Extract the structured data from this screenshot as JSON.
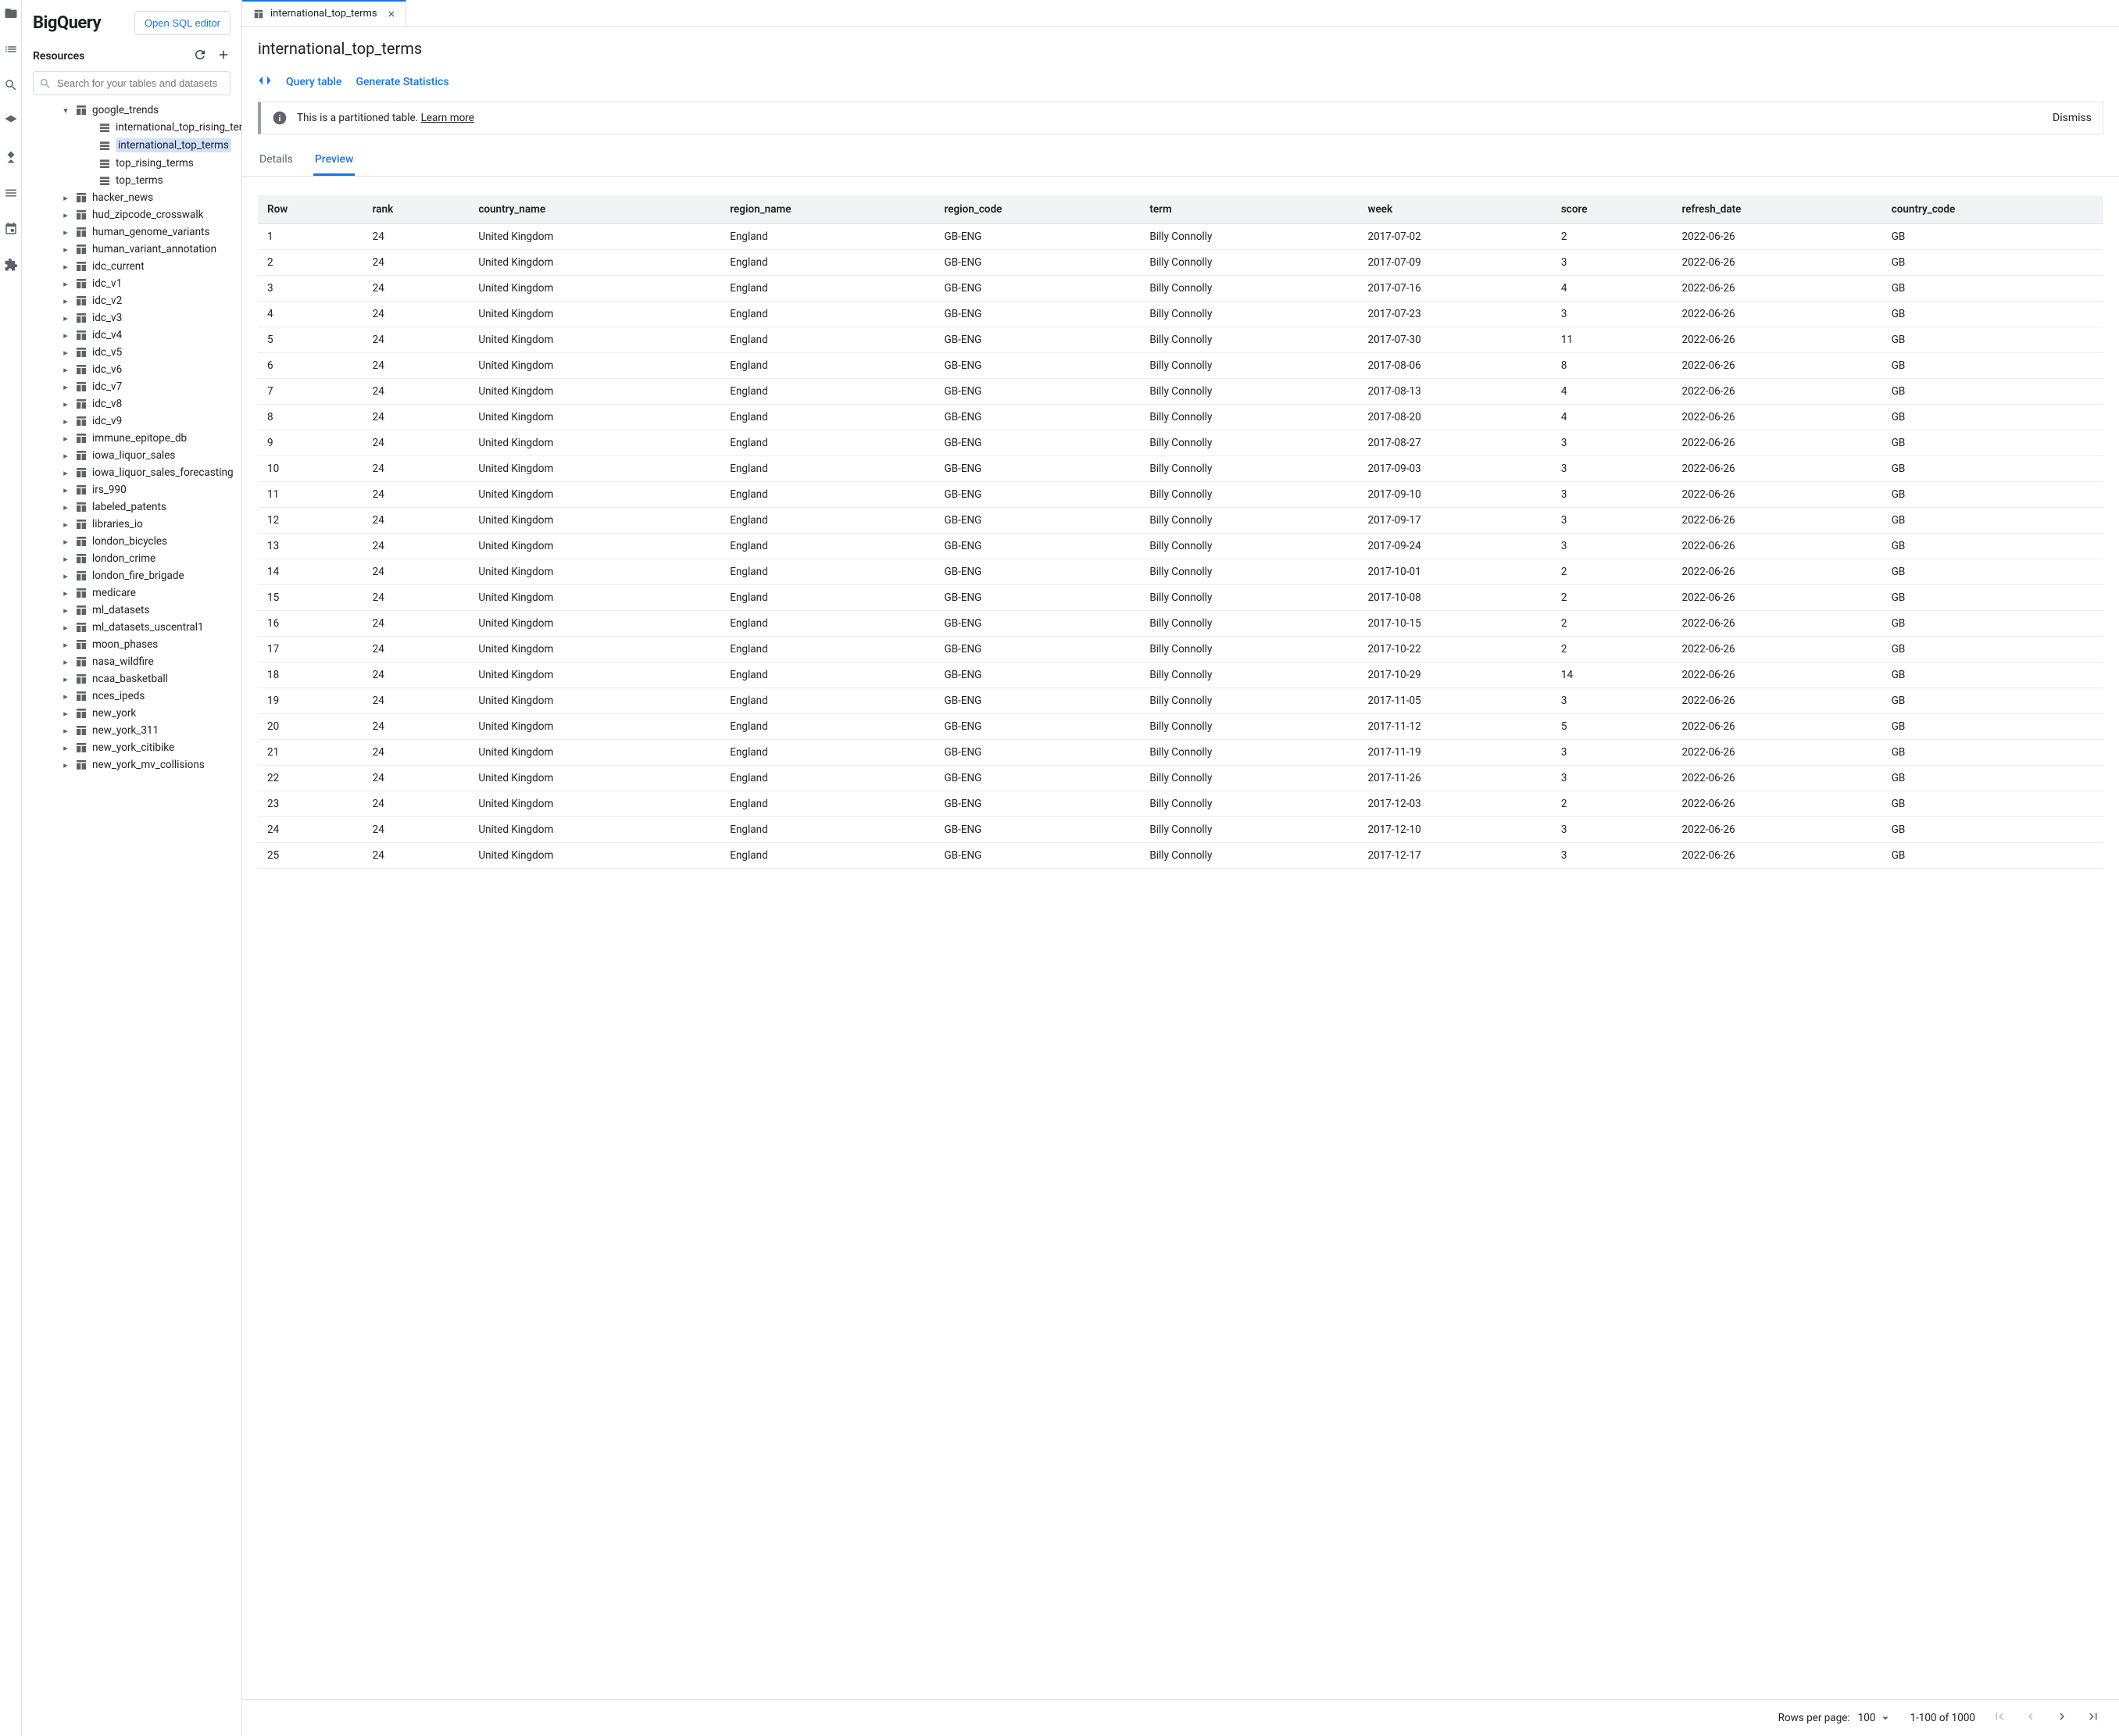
{
  "brand": "BigQuery",
  "open_sql": "Open SQL editor",
  "resources_label": "Resources",
  "search_placeholder": "Search for your tables and datasets",
  "tree": {
    "expanded": {
      "label": "google_trends",
      "children": [
        "international_top_rising_terms",
        "international_top_terms",
        "top_rising_terms",
        "top_terms"
      ],
      "selected_index": 1
    },
    "datasets": [
      "hacker_news",
      "hud_zipcode_crosswalk",
      "human_genome_variants",
      "human_variant_annotation",
      "idc_current",
      "idc_v1",
      "idc_v2",
      "idc_v3",
      "idc_v4",
      "idc_v5",
      "idc_v6",
      "idc_v7",
      "idc_v8",
      "idc_v9",
      "immune_epitope_db",
      "iowa_liquor_sales",
      "iowa_liquor_sales_forecasting",
      "irs_990",
      "labeled_patents",
      "libraries_io",
      "london_bicycles",
      "london_crime",
      "london_fire_brigade",
      "medicare",
      "ml_datasets",
      "ml_datasets_uscentral1",
      "moon_phases",
      "nasa_wildfire",
      "ncaa_basketball",
      "nces_ipeds",
      "new_york",
      "new_york_311",
      "new_york_citibike",
      "new_york_mv_collisions"
    ]
  },
  "tab": {
    "label": "international_top_terms"
  },
  "page_title": "international_top_terms",
  "actions": {
    "query": "Query table",
    "stats": "Generate Statistics"
  },
  "banner": {
    "text": "This is a partitioned table. ",
    "learn": "Learn more",
    "dismiss": "Dismiss"
  },
  "content_tabs": {
    "details": "Details",
    "preview": "Preview"
  },
  "columns": [
    "Row",
    "rank",
    "country_name",
    "region_name",
    "region_code",
    "term",
    "week",
    "score",
    "refresh_date",
    "country_code"
  ],
  "rows": [
    [
      "1",
      "24",
      "United Kingdom",
      "England",
      "GB-ENG",
      "Billy Connolly",
      "2017-07-02",
      "2",
      "2022-06-26",
      "GB"
    ],
    [
      "2",
      "24",
      "United Kingdom",
      "England",
      "GB-ENG",
      "Billy Connolly",
      "2017-07-09",
      "3",
      "2022-06-26",
      "GB"
    ],
    [
      "3",
      "24",
      "United Kingdom",
      "England",
      "GB-ENG",
      "Billy Connolly",
      "2017-07-16",
      "4",
      "2022-06-26",
      "GB"
    ],
    [
      "4",
      "24",
      "United Kingdom",
      "England",
      "GB-ENG",
      "Billy Connolly",
      "2017-07-23",
      "3",
      "2022-06-26",
      "GB"
    ],
    [
      "5",
      "24",
      "United Kingdom",
      "England",
      "GB-ENG",
      "Billy Connolly",
      "2017-07-30",
      "11",
      "2022-06-26",
      "GB"
    ],
    [
      "6",
      "24",
      "United Kingdom",
      "England",
      "GB-ENG",
      "Billy Connolly",
      "2017-08-06",
      "8",
      "2022-06-26",
      "GB"
    ],
    [
      "7",
      "24",
      "United Kingdom",
      "England",
      "GB-ENG",
      "Billy Connolly",
      "2017-08-13",
      "4",
      "2022-06-26",
      "GB"
    ],
    [
      "8",
      "24",
      "United Kingdom",
      "England",
      "GB-ENG",
      "Billy Connolly",
      "2017-08-20",
      "4",
      "2022-06-26",
      "GB"
    ],
    [
      "9",
      "24",
      "United Kingdom",
      "England",
      "GB-ENG",
      "Billy Connolly",
      "2017-08-27",
      "3",
      "2022-06-26",
      "GB"
    ],
    [
      "10",
      "24",
      "United Kingdom",
      "England",
      "GB-ENG",
      "Billy Connolly",
      "2017-09-03",
      "3",
      "2022-06-26",
      "GB"
    ],
    [
      "11",
      "24",
      "United Kingdom",
      "England",
      "GB-ENG",
      "Billy Connolly",
      "2017-09-10",
      "3",
      "2022-06-26",
      "GB"
    ],
    [
      "12",
      "24",
      "United Kingdom",
      "England",
      "GB-ENG",
      "Billy Connolly",
      "2017-09-17",
      "3",
      "2022-06-26",
      "GB"
    ],
    [
      "13",
      "24",
      "United Kingdom",
      "England",
      "GB-ENG",
      "Billy Connolly",
      "2017-09-24",
      "3",
      "2022-06-26",
      "GB"
    ],
    [
      "14",
      "24",
      "United Kingdom",
      "England",
      "GB-ENG",
      "Billy Connolly",
      "2017-10-01",
      "2",
      "2022-06-26",
      "GB"
    ],
    [
      "15",
      "24",
      "United Kingdom",
      "England",
      "GB-ENG",
      "Billy Connolly",
      "2017-10-08",
      "2",
      "2022-06-26",
      "GB"
    ],
    [
      "16",
      "24",
      "United Kingdom",
      "England",
      "GB-ENG",
      "Billy Connolly",
      "2017-10-15",
      "2",
      "2022-06-26",
      "GB"
    ],
    [
      "17",
      "24",
      "United Kingdom",
      "England",
      "GB-ENG",
      "Billy Connolly",
      "2017-10-22",
      "2",
      "2022-06-26",
      "GB"
    ],
    [
      "18",
      "24",
      "United Kingdom",
      "England",
      "GB-ENG",
      "Billy Connolly",
      "2017-10-29",
      "14",
      "2022-06-26",
      "GB"
    ],
    [
      "19",
      "24",
      "United Kingdom",
      "England",
      "GB-ENG",
      "Billy Connolly",
      "2017-11-05",
      "3",
      "2022-06-26",
      "GB"
    ],
    [
      "20",
      "24",
      "United Kingdom",
      "England",
      "GB-ENG",
      "Billy Connolly",
      "2017-11-12",
      "5",
      "2022-06-26",
      "GB"
    ],
    [
      "21",
      "24",
      "United Kingdom",
      "England",
      "GB-ENG",
      "Billy Connolly",
      "2017-11-19",
      "3",
      "2022-06-26",
      "GB"
    ],
    [
      "22",
      "24",
      "United Kingdom",
      "England",
      "GB-ENG",
      "Billy Connolly",
      "2017-11-26",
      "3",
      "2022-06-26",
      "GB"
    ],
    [
      "23",
      "24",
      "United Kingdom",
      "England",
      "GB-ENG",
      "Billy Connolly",
      "2017-12-03",
      "2",
      "2022-06-26",
      "GB"
    ],
    [
      "24",
      "24",
      "United Kingdom",
      "England",
      "GB-ENG",
      "Billy Connolly",
      "2017-12-10",
      "3",
      "2022-06-26",
      "GB"
    ],
    [
      "25",
      "24",
      "United Kingdom",
      "England",
      "GB-ENG",
      "Billy Connolly",
      "2017-12-17",
      "3",
      "2022-06-26",
      "GB"
    ]
  ],
  "pager": {
    "rpp_label": "Rows per page:",
    "rpp_value": "100",
    "range": "1-100 of 1000"
  }
}
